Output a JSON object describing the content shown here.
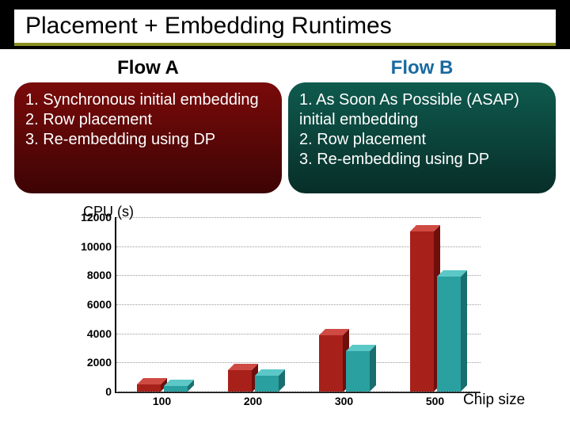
{
  "title": "Placement + Embedding Runtimes",
  "flowA": {
    "heading": "Flow A",
    "body": "1. Synchronous initial embedding\n2. Row placement\n3. Re-embedding using DP"
  },
  "flowB": {
    "heading": "Flow B",
    "body": "1. As Soon As Possible (ASAP) initial embedding\n2. Row placement\n3. Re-embedding using DP"
  },
  "chart_data": {
    "type": "bar",
    "title": "",
    "ylabel": "CPU (s)",
    "xlabel": "Chip size",
    "categories": [
      "100",
      "200",
      "300",
      "500"
    ],
    "series": [
      {
        "name": "Flow A",
        "color": "#a8201a",
        "values": [
          500,
          1500,
          3900,
          11000
        ]
      },
      {
        "name": "Flow B",
        "color": "#2aa0a0",
        "values": [
          400,
          1100,
          2800,
          7900
        ]
      }
    ],
    "ylim": [
      0,
      12000
    ],
    "yticks": [
      0,
      2000,
      4000,
      6000,
      8000,
      10000,
      12000
    ]
  }
}
